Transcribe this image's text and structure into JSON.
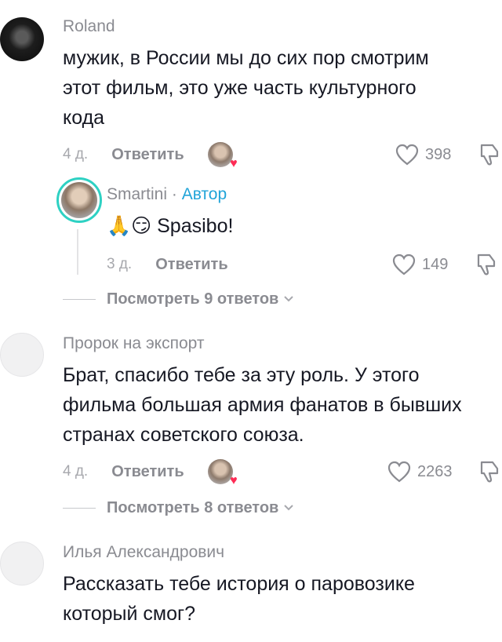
{
  "comments": [
    {
      "username": "Roland",
      "lines": [
        "мужик, в России мы до сих пор смотрим",
        "этот фильм, это уже часть культурного",
        "кода"
      ],
      "time": "4 д.",
      "reply_label": "Ответить",
      "likes": "398"
    },
    {
      "username": "Пророк на экспорт",
      "lines": [
        "Брат, спасибо тебе за эту роль. У этого",
        "фильма большая армия фанатов в бывших",
        "странах советского союза."
      ],
      "time": "4 д.",
      "reply_label": "Ответить",
      "likes": "2263",
      "view_replies": "Посмотреть 8 ответов"
    },
    {
      "username": "Илья Александрович",
      "lines": [
        "Рассказать тебе история о паровозике",
        "который смог?"
      ]
    }
  ],
  "reply": {
    "username": "Smartini",
    "separator": "·",
    "author_tag": "Автор",
    "text": "🙏😏 Spasibo!",
    "time": "3 д.",
    "reply_label": "Ответить",
    "likes": "149"
  },
  "first_view_replies": "Посмотреть 9 ответов",
  "colors": {
    "author": "#20a4d8",
    "ring": "#2ed1c3",
    "heart": "#fe2c55"
  }
}
